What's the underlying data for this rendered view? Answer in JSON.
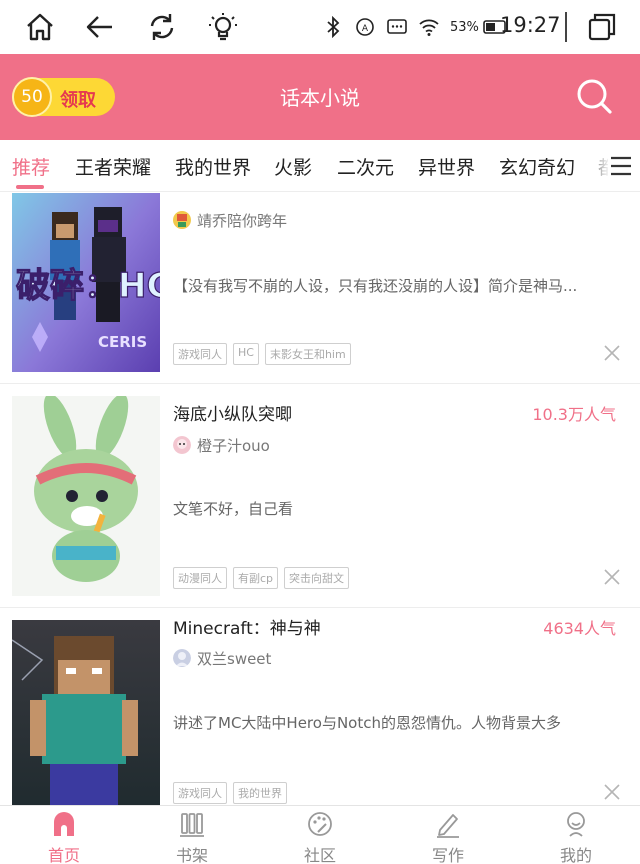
{
  "status_bar": {
    "battery_percent": "53%",
    "time": "19:27"
  },
  "header": {
    "coin_count": "50",
    "coin_action": "领取",
    "title": "话本小说"
  },
  "tabs": [
    "推荐",
    "王者荣耀",
    "我的世界",
    "火影",
    "二次元",
    "异世界",
    "玄幻奇幻",
    "都"
  ],
  "active_tab_index": 0,
  "accent_color": "#f07088",
  "cards": [
    {
      "title": "",
      "popularity": "",
      "author": "靖乔陪你跨年",
      "summary": "【没有我写不崩的人设，只有我还没崩的人设】简介是神马...",
      "tags": [
        "游戏同人",
        "HC",
        "末影女王和him"
      ],
      "cover_text": "破碎：HC",
      "cover_caption": "CERIS"
    },
    {
      "title": "海底小纵队突唧",
      "popularity": "10.3万人气",
      "author": "橙子汁ouo",
      "summary": "文笔不好，自己看",
      "tags": [
        "动漫同人",
        "有副cp",
        "突击向甜文"
      ]
    },
    {
      "title": "Minecraft：神与神",
      "popularity": "4634人气",
      "author": "双兰sweet",
      "summary": "讲述了MC大陆中Hero与Notch的恩怨情仇。人物背景大多",
      "tags": [
        "游戏同人",
        "我的世界"
      ]
    }
  ],
  "bottom_nav": [
    "首页",
    "书架",
    "社区",
    "写作",
    "我的"
  ],
  "active_nav_index": 0
}
